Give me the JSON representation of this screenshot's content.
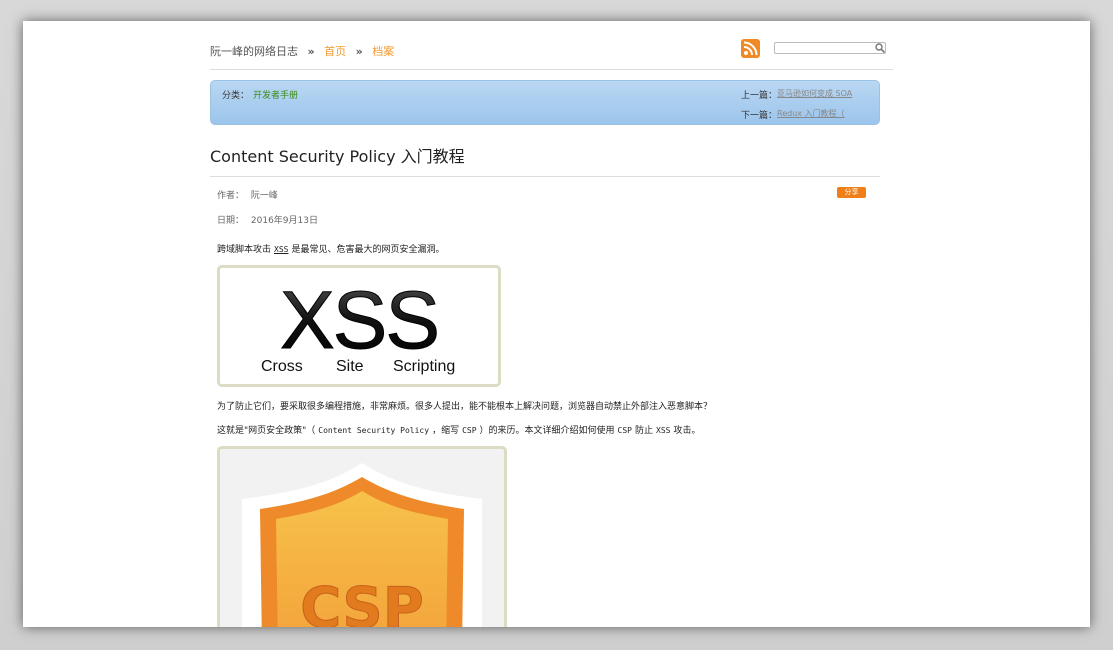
{
  "header": {
    "blog_name": "阮一峰的网络日志",
    "separator": "»",
    "home": "首页",
    "archive": "档案",
    "search_placeholder": ""
  },
  "category_bar": {
    "category_label": "分类：",
    "category_value": "开发者手册",
    "prev_label": "上一篇：",
    "prev_link": "亚马逊如何变成 SOA",
    "next_label": "下一篇：",
    "next_link": "Redux 入门教程（"
  },
  "article": {
    "title": "Content Security Policy 入门教程",
    "author_label": "作者：",
    "author": "阮一峰",
    "date_label": "日期：",
    "date": "2016年9月13日",
    "share": "分享",
    "p1_a": "跨域脚本攻击",
    "p1_code": "XSS",
    "p1_b": "是最常见、危害最大的网页安全漏洞。",
    "p2": "为了防止它们，要采取很多编程措施，非常麻烦。很多人提出，能不能根本上解决问题，浏览器自动禁止外部注入恶意脚本？",
    "p3_a": "这就是\"网页安全政策\"（",
    "p3_code1": "Content Security Policy",
    "p3_b": "，缩写",
    "p3_code2": "CSP",
    "p3_c": "）的来历。本文详细介绍如何使用",
    "p3_code3": "CSP",
    "p3_d": "防止",
    "p3_code4": "XSS",
    "p3_e": "攻击。"
  },
  "xss_image": {
    "big": "XSS",
    "w1": "Cross",
    "w2": "Site",
    "w3": "Scripting"
  },
  "csp_image": {
    "text": "CSP"
  },
  "colors": {
    "accent_orange": "#f29a2e",
    "category_green": "#3a8a1a",
    "bar_blue": "#a9cdef"
  },
  "icons": [
    "rss-icon",
    "search-icon"
  ]
}
